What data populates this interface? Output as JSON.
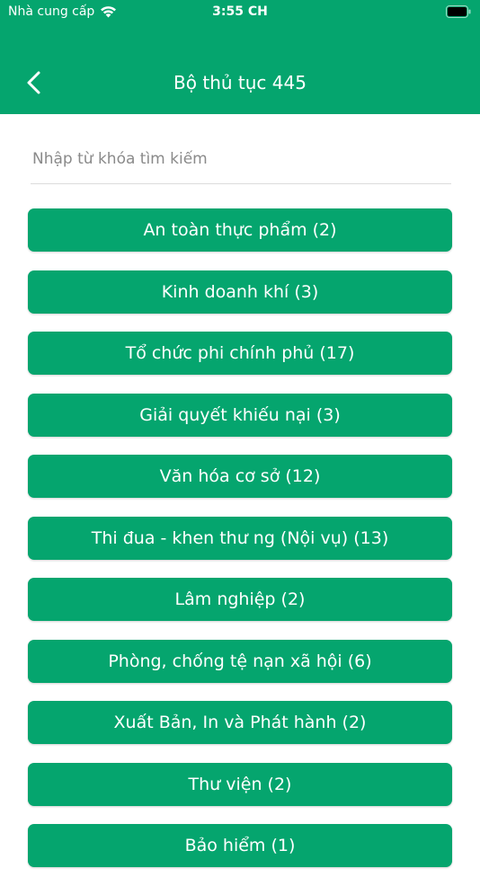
{
  "status_bar": {
    "carrier": "Nhà cung cấp",
    "time": "3:55 CH"
  },
  "header": {
    "title": "Bộ thủ tục 445",
    "back_icon": "chevron-left-icon"
  },
  "search": {
    "placeholder": "Nhập từ khóa tìm kiếm",
    "value": ""
  },
  "items": [
    {
      "label": "An toàn thực phẩm (2)"
    },
    {
      "label": "Kinh doanh khí (3)"
    },
    {
      "label": "Tổ chức phi chính phủ (17)"
    },
    {
      "label": "Giải quyết khiếu nại (3)"
    },
    {
      "label": "Văn hóa cơ sở (12)"
    },
    {
      "label": "Thi đua - khen thư  ng (Nội vụ) (13)"
    },
    {
      "label": "Lâm nghiệp (2)"
    },
    {
      "label": "Phòng, chống tệ nạn xã hội (6)"
    },
    {
      "label": "Xuất Bản, In và Phát hành (2)"
    },
    {
      "label": "Thư viện (2)"
    },
    {
      "label": "Bảo hiểm (1)"
    }
  ],
  "colors": {
    "primary": "#05a56e",
    "text_on_primary": "#ffffff",
    "placeholder": "#8a8a8a",
    "divider": "#dcdcdc"
  }
}
